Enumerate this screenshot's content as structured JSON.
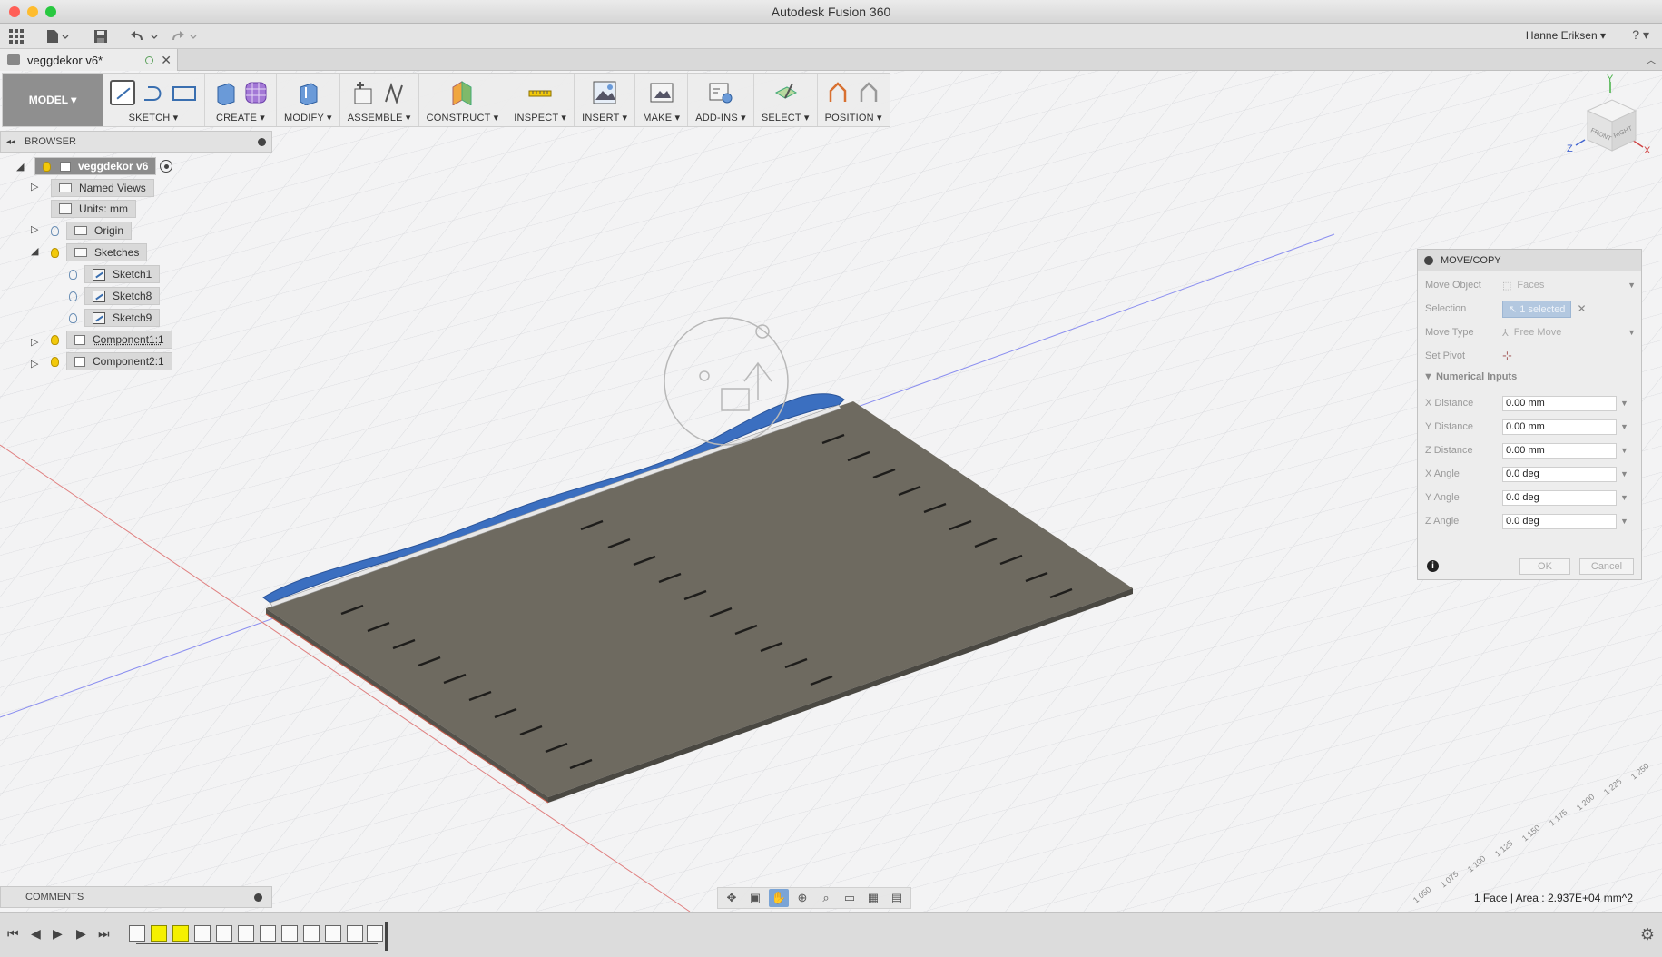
{
  "app": {
    "title": "Autodesk Fusion 360",
    "user": "Hanne Eriksen ▾",
    "help": "? ▾"
  },
  "document_tab": {
    "name": "veggdekor v6*"
  },
  "ribbon": {
    "workspace": "MODEL ▾",
    "groups": [
      {
        "label": "SKETCH ▾"
      },
      {
        "label": "CREATE ▾"
      },
      {
        "label": "MODIFY ▾"
      },
      {
        "label": "ASSEMBLE ▾"
      },
      {
        "label": "CONSTRUCT ▾"
      },
      {
        "label": "INSPECT ▾"
      },
      {
        "label": "INSERT ▾"
      },
      {
        "label": "MAKE ▾"
      },
      {
        "label": "ADD-INS ▾"
      },
      {
        "label": "SELECT ▾"
      },
      {
        "label": "POSITION ▾"
      }
    ]
  },
  "browser": {
    "title": "BROWSER",
    "root": "veggdekor v6",
    "items": [
      {
        "label": "Named Views"
      },
      {
        "label": "Units: mm"
      },
      {
        "label": "Origin"
      },
      {
        "label": "Sketches"
      },
      {
        "label": "Sketch1"
      },
      {
        "label": "Sketch8"
      },
      {
        "label": "Sketch9"
      },
      {
        "label": "Component1:1"
      },
      {
        "label": "Component2:1"
      }
    ]
  },
  "viewcube": {
    "front": "FRONT",
    "right": "RIGHT",
    "axis_x": "X",
    "axis_y": "Y",
    "axis_z": "Z"
  },
  "dialog": {
    "title": "MOVE/COPY",
    "move_object_label": "Move Object",
    "move_object_value": "Faces",
    "selection_label": "Selection",
    "selection_value": "1 selected",
    "move_type_label": "Move Type",
    "move_type_value": "Free Move",
    "set_pivot_label": "Set Pivot",
    "section": "Numerical Inputs",
    "inputs": [
      {
        "label": "X Distance",
        "value": "0.00 mm"
      },
      {
        "label": "Y Distance",
        "value": "0.00 mm"
      },
      {
        "label": "Z Distance",
        "value": "0.00 mm"
      },
      {
        "label": "X Angle",
        "value": "0.0 deg"
      },
      {
        "label": "Y Angle",
        "value": "0.0 deg"
      },
      {
        "label": "Z Angle",
        "value": "0.0 deg"
      }
    ],
    "ok": "OK",
    "cancel": "Cancel"
  },
  "comments": {
    "title": "COMMENTS"
  },
  "status": {
    "text": "1 Face | Area : 2.937E+04 mm^2"
  },
  "colors": {
    "plate": "#6e6a60",
    "blue_part": "#3b6fc0",
    "accent": "#7aa4d6"
  }
}
